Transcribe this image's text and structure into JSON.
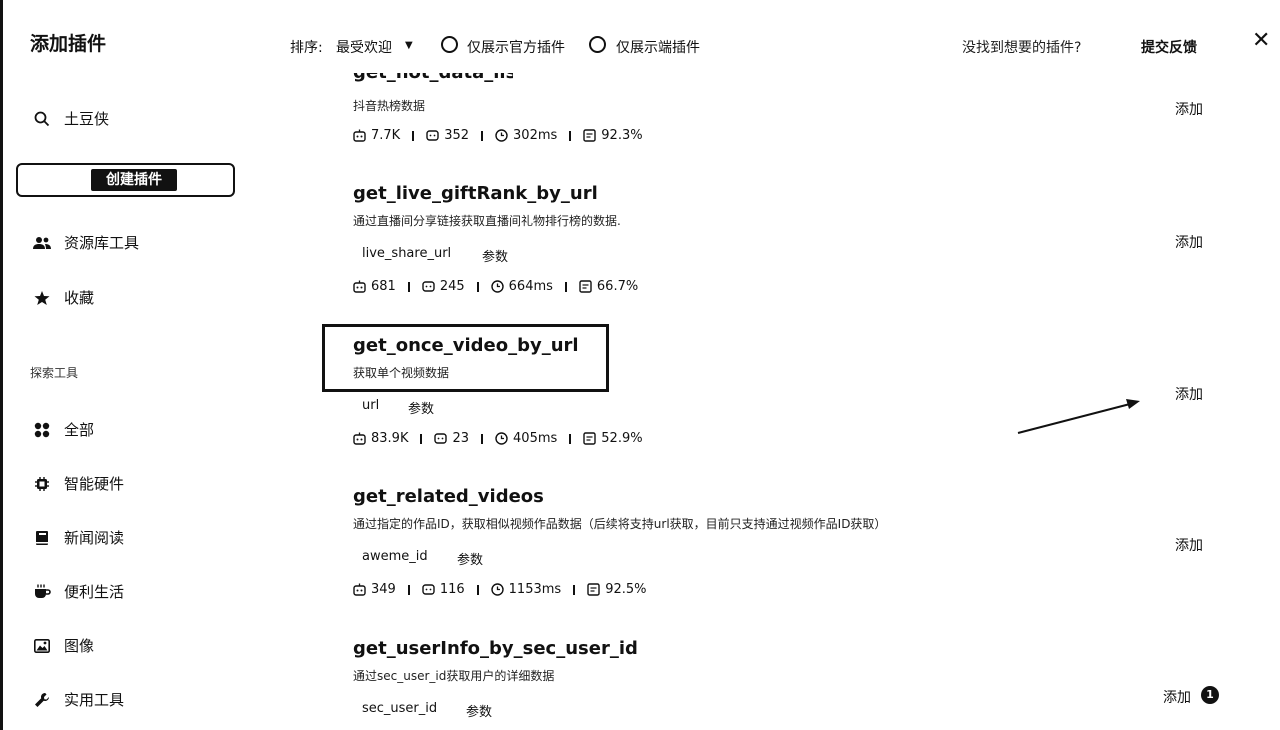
{
  "header": {
    "title": "添加插件",
    "sort_label": "排序:",
    "sort_value": "最受欢迎",
    "filter_official": "仅展示官方插件",
    "filter_device": "仅展示端插件",
    "not_found": "没找到想要的插件?",
    "feedback": "提交反馈",
    "close": "✕"
  },
  "sidebar": {
    "user": "土豆侠",
    "create_button": "创建插件",
    "library": "资源库工具",
    "favorites": "收藏",
    "explore_label": "探索工具",
    "categories": [
      "全部",
      "智能硬件",
      "新闻阅读",
      "便利生活",
      "图像",
      "实用工具"
    ]
  },
  "plugins": [
    {
      "name": "get_hot_data_list",
      "desc": "抖音热榜数据",
      "params": [],
      "stats": {
        "usage": "7.7K",
        "comments": "352",
        "latency": "302ms",
        "success": "92.3%"
      },
      "add": "添加"
    },
    {
      "name": "get_live_giftRank_by_url",
      "desc": "通过直播间分享链接获取直播间礼物排行榜的数据.",
      "params": [
        "live_share_url",
        "参数"
      ],
      "stats": {
        "usage": "681",
        "comments": "245",
        "latency": "664ms",
        "success": "66.7%"
      },
      "add": "添加"
    },
    {
      "name": "get_once_video_by_url",
      "desc": "获取单个视频数据",
      "params": [
        "url",
        "参数"
      ],
      "stats": {
        "usage": "83.9K",
        "comments": "23",
        "latency": "405ms",
        "success": "52.9%"
      },
      "add": "添加"
    },
    {
      "name": "get_related_videos",
      "desc": "通过指定的作品ID，获取相似视频作品数据（后续将支持url获取，目前只支持通过视频作品ID获取）",
      "params": [
        "aweme_id",
        "参数"
      ],
      "stats": {
        "usage": "349",
        "comments": "116",
        "latency": "1153ms",
        "success": "92.5%"
      },
      "add": "添加"
    },
    {
      "name": "get_userInfo_by_sec_user_id",
      "desc": "通过sec_user_id获取用户的详细数据",
      "params": [
        "sec_user_id",
        "参数"
      ],
      "add": "添加",
      "badge": "1"
    }
  ]
}
